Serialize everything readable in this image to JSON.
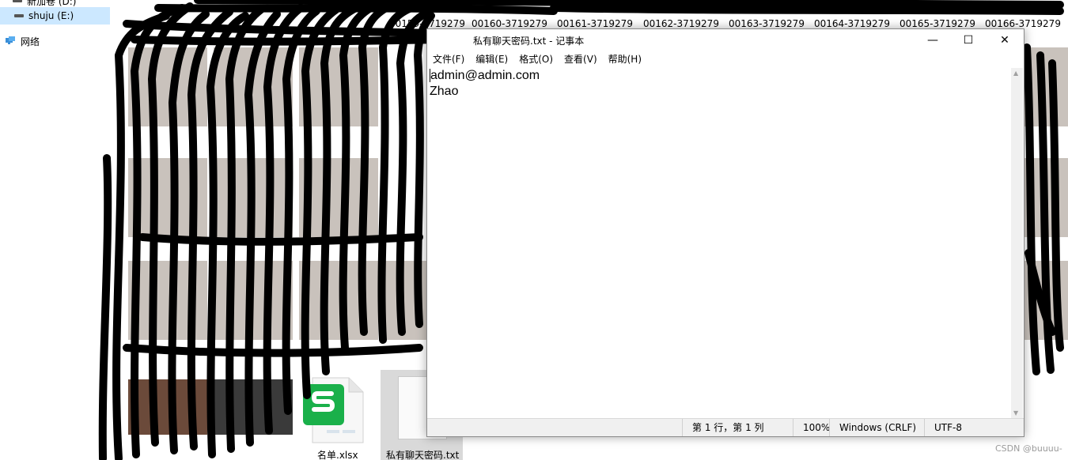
{
  "nav": {
    "top_item": "新加卷 (D:)",
    "drive": "shuju (E:)",
    "network": "网络"
  },
  "top_files": [
    "00159-3719279",
    "00160-3719279",
    "00161-3719279",
    "00162-3719279",
    "00163-3719279",
    "00164-3719279",
    "00165-3719279",
    "00166-3719279"
  ],
  "bottom_files": {
    "xlsx_name": "名单.xlsx",
    "txt_name": "私有聊天密码.txt"
  },
  "notepad": {
    "title": "私有聊天密码.txt - 记事本",
    "controls": {
      "minimize": "—",
      "maximize": "☐",
      "close": "✕"
    },
    "menu": [
      "文件(F)",
      "编辑(E)",
      "格式(O)",
      "查看(V)",
      "帮助(H)"
    ],
    "lines": [
      "admin@admin.com",
      "Zhao"
    ],
    "status": {
      "position": "第 1 行，第 1 列",
      "zoom": "100%",
      "line_ending": "Windows (CRLF)",
      "encoding": "UTF-8"
    }
  },
  "watermark": "CSDN @buuuu-",
  "icons": {
    "network": "network-icon",
    "drive": "drive-icon",
    "xlsx": "spreadsheet-file-icon",
    "txt": "text-file-icon"
  },
  "colors": {
    "selection": "#cce8ff",
    "xlsx_green": "#1ab04a"
  }
}
